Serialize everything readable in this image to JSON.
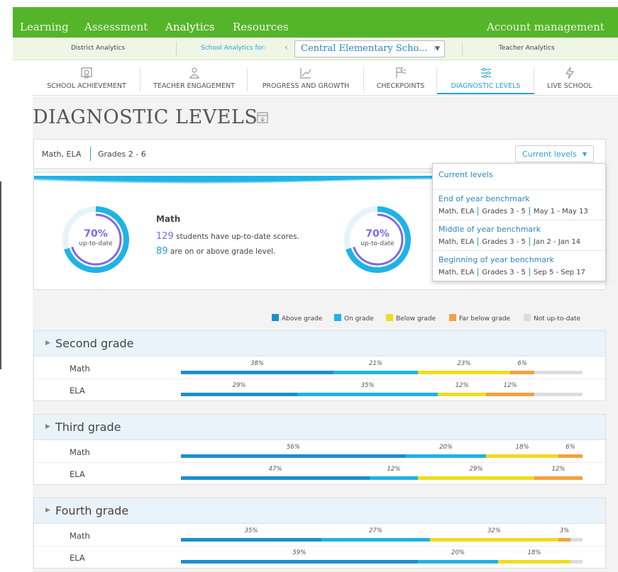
{
  "topnav": {
    "items": [
      "Learning",
      "Assessment",
      "Analytics",
      "Resources"
    ],
    "active": "Analytics",
    "account": "Account management"
  },
  "subnav": {
    "district": "District Analytics",
    "school_label": "School Analytics for:",
    "school_value": "Central Elementary Scho...",
    "teacher": "Teacher Analytics"
  },
  "tabs": [
    {
      "label": "SCHOOL ACHIEVEMENT",
      "icon": "certificate-icon"
    },
    {
      "label": "TEACHER ENGAGEMENT",
      "icon": "teacher-icon"
    },
    {
      "label": "PROGRESS AND GROWTH",
      "icon": "growth-chart-icon"
    },
    {
      "label": "CHECKPOINTS",
      "icon": "flag-icon"
    },
    {
      "label": "DIAGNOSTIC LEVELS",
      "icon": "sliders-icon"
    },
    {
      "label": "LIVE SCHOOL",
      "icon": "lightning-icon"
    }
  ],
  "active_tab": "DIAGNOSTIC LEVELS",
  "page_title": "DIAGNOSTIC LEVELS",
  "filters": {
    "subjects": "Math, ELA",
    "grades": "Grades 2 - 6"
  },
  "levels_button": "Current levels",
  "dropdown": {
    "items": [
      {
        "name": "Current levels"
      },
      {
        "name": "End of year benchmark",
        "subjects": "Math, ELA",
        "grades": "Grades 3 - 5",
        "dates": "May 1 - May 13"
      },
      {
        "name": "Middle of year benchmark",
        "subjects": "Math, ELA",
        "grades": "Grades 3 - 5",
        "dates": "Jan 2 - Jan 14"
      },
      {
        "name": "Beginning of year benchmark",
        "subjects": "Math, ELA",
        "grades": "Grades 3 - 5",
        "dates": "Sep 5 - Sep 17"
      }
    ]
  },
  "summary": [
    {
      "percent": "70%",
      "percent_value": 70,
      "caption": "up-to-date",
      "subject": "Math",
      "students": "129",
      "students_text": " students have up-to-date scores.",
      "on_level": "89",
      "on_level_text": " are on or above grade level."
    },
    {
      "percent": "70%",
      "percent_value": 70,
      "caption": "up-to-date"
    }
  ],
  "legend": [
    {
      "label": "Above grade",
      "color": "#1a8fd0"
    },
    {
      "label": "On grade",
      "color": "#1eb3e8"
    },
    {
      "label": "Below grade",
      "color": "#f0dc1e"
    },
    {
      "label": "Far below grade",
      "color": "#f4a040"
    },
    {
      "label": "Not up-to-date",
      "color": "#dcdcdc"
    }
  ],
  "chart_data": {
    "type": "bar",
    "stacked": true,
    "series_names": [
      "Above grade",
      "On grade",
      "Below grade",
      "Far below grade",
      "Not up-to-date"
    ],
    "grades": [
      {
        "name": "Second grade",
        "rows": [
          {
            "subject": "Math",
            "values": [
              38,
              21,
              23,
              6,
              12
            ],
            "labels": [
              "38%",
              "21%",
              "23%",
              "6%",
              ""
            ]
          },
          {
            "subject": "ELA",
            "values": [
              29,
              35,
              12,
              12,
              12
            ],
            "labels": [
              "29%",
              "35%",
              "12%",
              "12%",
              ""
            ]
          }
        ]
      },
      {
        "name": "Third grade",
        "rows": [
          {
            "subject": "Math",
            "values": [
              56,
              20,
              18,
              6,
              0
            ],
            "labels": [
              "56%",
              "20%",
              "18%",
              "6%",
              ""
            ]
          },
          {
            "subject": "ELA",
            "values": [
              47,
              12,
              29,
              12,
              0
            ],
            "labels": [
              "47%",
              "12%",
              "29%",
              "12%",
              ""
            ]
          }
        ]
      },
      {
        "name": "Fourth grade",
        "rows": [
          {
            "subject": "Math",
            "values": [
              35,
              27,
              32,
              3,
              3
            ],
            "labels": [
              "35%",
              "27%",
              "32%",
              "3%",
              ""
            ]
          },
          {
            "subject": "ELA",
            "values": [
              59,
              20,
              18,
              0,
              3
            ],
            "labels": [
              "59%",
              "20%",
              "18%",
              "",
              ""
            ]
          }
        ]
      }
    ]
  }
}
